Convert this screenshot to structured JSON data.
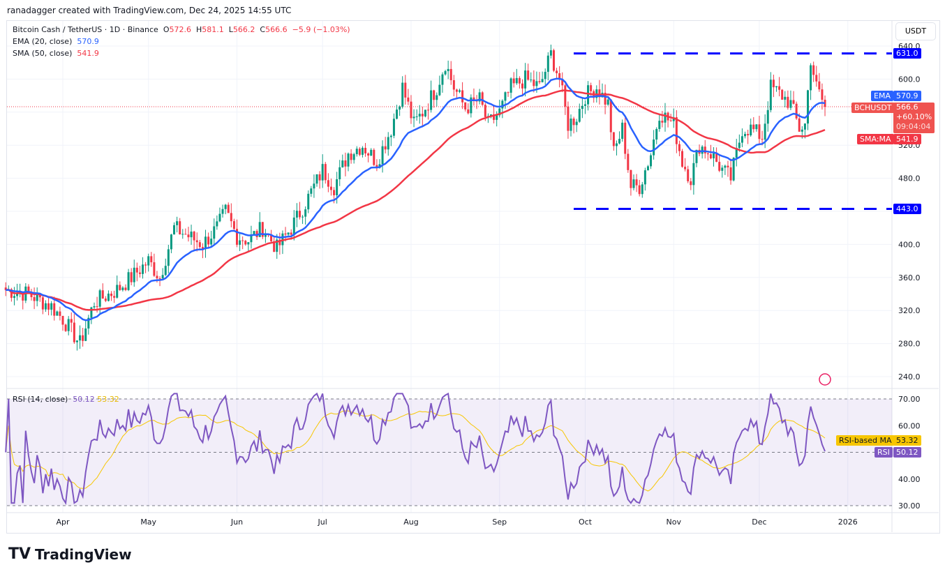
{
  "header": {
    "credit": "ranadagger created with TradingView.com, Dec 24, 2025 14:55 UTC"
  },
  "legend": {
    "symbol": "Bitcoin Cash / TetherUS · 1D · Binance",
    "o_label": "O",
    "o": "572.6",
    "h_label": "H",
    "h": "581.1",
    "l_label": "L",
    "l": "566.2",
    "c_label": "C",
    "c": "566.6",
    "change": "−5.9 (−1.03%)",
    "ema_label": "EMA (20, close)",
    "ema": "570.9",
    "sma_label": "SMA (50, close)",
    "sma": "541.9",
    "rsi_label": "RSI (14, close)",
    "rsi": "50.12",
    "rsi_ma": "53.32"
  },
  "axis": {
    "currency": "USDT",
    "price_ticks": [
      640,
      600,
      560,
      520,
      480,
      440,
      400,
      360,
      320,
      280,
      240
    ],
    "rsi_ticks": [
      "70.00",
      "60.00",
      "40.00",
      "30.00"
    ],
    "time_ticks": [
      "Apr",
      "May",
      "Jun",
      "Jul",
      "Aug",
      "Sep",
      "Oct",
      "Nov",
      "Dec",
      "2026"
    ]
  },
  "tags": {
    "resistance": "631.0",
    "support": "443.0",
    "ema_name": "EMA",
    "ema_val": "570.9",
    "sym_name": "BCHUSDT",
    "price": "566.6",
    "pct": "+60.10%",
    "countdown": "09:04:04",
    "sma_name": "SMA:MA",
    "sma_val": "541.9",
    "rsi_ma_name": "RSI-based MA",
    "rsi_ma_val": "53.32",
    "rsi_name": "RSI",
    "rsi_val": "50.12"
  },
  "colors": {
    "up": "#089981",
    "down": "#f23645",
    "ema": "#2962ff",
    "sma": "#f23645",
    "rsi": "#7e57c2",
    "rsi_ma": "#f7c600",
    "level": "#0000ff"
  },
  "brand": "TradingView",
  "chart_data": {
    "type": "candlestick",
    "ylim": [
      230,
      660
    ],
    "rsi_ylim": [
      30,
      70
    ],
    "levels": [
      631.0,
      443.0
    ],
    "closes": [
      [
        "2025-03-12",
        345
      ],
      [
        "2025-03-20",
        340
      ],
      [
        "2025-03-28",
        325
      ],
      [
        "2025-04-01",
        310
      ],
      [
        "2025-04-07",
        280
      ],
      [
        "2025-04-09",
        300
      ],
      [
        "2025-04-12",
        330
      ],
      [
        "2025-04-20",
        345
      ],
      [
        "2025-04-25",
        360
      ],
      [
        "2025-05-01",
        380
      ],
      [
        "2025-05-05",
        360
      ],
      [
        "2025-05-10",
        420
      ],
      [
        "2025-05-15",
        410
      ],
      [
        "2025-05-20",
        400
      ],
      [
        "2025-05-25",
        420
      ],
      [
        "2025-05-28",
        440
      ],
      [
        "2025-06-01",
        410
      ],
      [
        "2025-06-05",
        405
      ],
      [
        "2025-06-10",
        420
      ],
      [
        "2025-06-15",
        395
      ],
      [
        "2025-06-20",
        420
      ],
      [
        "2025-06-25",
        450
      ],
      [
        "2025-07-01",
        490
      ],
      [
        "2025-07-05",
        470
      ],
      [
        "2025-07-10",
        510
      ],
      [
        "2025-07-15",
        520
      ],
      [
        "2025-07-20",
        500
      ],
      [
        "2025-07-25",
        540
      ],
      [
        "2025-07-29",
        590
      ],
      [
        "2025-08-02",
        545
      ],
      [
        "2025-08-05",
        560
      ],
      [
        "2025-08-10",
        590
      ],
      [
        "2025-08-13",
        620
      ],
      [
        "2025-08-16",
        590
      ],
      [
        "2025-08-20",
        565
      ],
      [
        "2025-08-25",
        575
      ],
      [
        "2025-08-28",
        545
      ],
      [
        "2025-09-01",
        560
      ],
      [
        "2025-09-05",
        590
      ],
      [
        "2025-09-10",
        600
      ],
      [
        "2025-09-15",
        590
      ],
      [
        "2025-09-19",
        630
      ],
      [
        "2025-09-22",
        600
      ],
      [
        "2025-09-25",
        545
      ],
      [
        "2025-09-28",
        555
      ],
      [
        "2025-10-01",
        580
      ],
      [
        "2025-10-05",
        590
      ],
      [
        "2025-10-09",
        570
      ],
      [
        "2025-10-11",
        510
      ],
      [
        "2025-10-14",
        540
      ],
      [
        "2025-10-17",
        470
      ],
      [
        "2025-10-20",
        470
      ],
      [
        "2025-10-24",
        510
      ],
      [
        "2025-10-27",
        560
      ],
      [
        "2025-11-01",
        545
      ],
      [
        "2025-11-04",
        500
      ],
      [
        "2025-11-07",
        480
      ],
      [
        "2025-11-10",
        520
      ],
      [
        "2025-11-14",
        510
      ],
      [
        "2025-11-18",
        490
      ],
      [
        "2025-11-21",
        480
      ],
      [
        "2025-11-25",
        540
      ],
      [
        "2025-11-28",
        540
      ],
      [
        "2025-12-02",
        530
      ],
      [
        "2025-12-05",
        590
      ],
      [
        "2025-12-09",
        580
      ],
      [
        "2025-12-12",
        570
      ],
      [
        "2025-12-15",
        540
      ],
      [
        "2025-12-17",
        545
      ],
      [
        "2025-12-19",
        625
      ],
      [
        "2025-12-21",
        590
      ],
      [
        "2025-12-24",
        566.6
      ]
    ]
  }
}
